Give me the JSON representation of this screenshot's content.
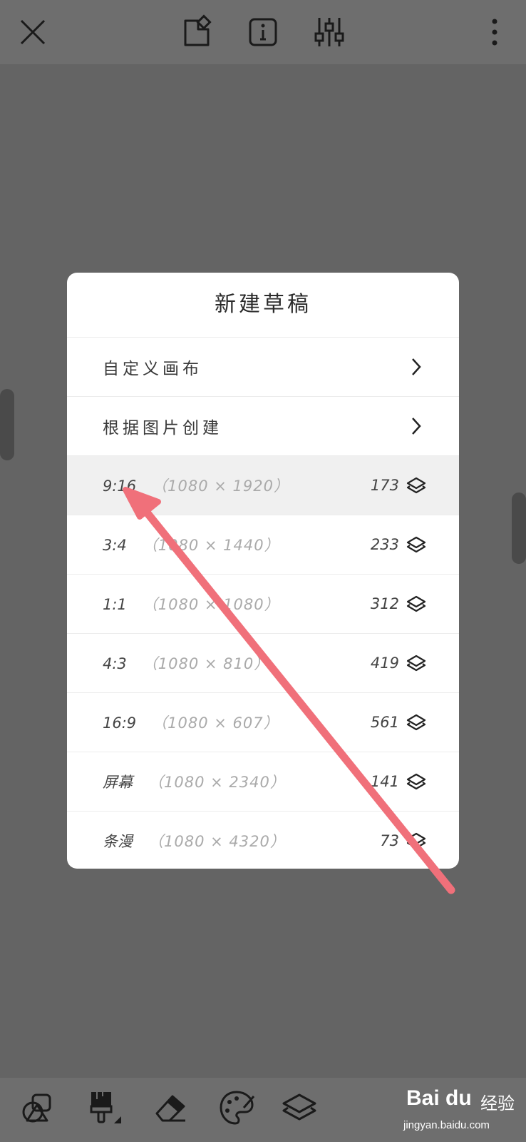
{
  "topbar": {
    "icons": [
      "close-icon",
      "canvas-tag-icon",
      "info-icon",
      "sliders-icon",
      "more-vertical-icon"
    ]
  },
  "dialog": {
    "title": "新建草稿",
    "nav_rows": [
      {
        "label": "自定义画布",
        "icon": "chevron-right-icon"
      },
      {
        "label": "根据图片创建",
        "icon": "chevron-right-icon"
      }
    ],
    "presets": [
      {
        "ratio": "9:16",
        "size": "（1080 × 1920）",
        "layers": "173",
        "highlighted": true
      },
      {
        "ratio": "3:4",
        "size": "（1080 × 1440）",
        "layers": "233",
        "highlighted": false
      },
      {
        "ratio": "1:1",
        "size": "（1080 × 1080）",
        "layers": "312",
        "highlighted": false
      },
      {
        "ratio": "4:3",
        "size": "（1080 × 810）",
        "layers": "419",
        "highlighted": false
      },
      {
        "ratio": "16:9",
        "size": "（1080 × 607）",
        "layers": "561",
        "highlighted": false
      },
      {
        "ratio": "屏幕",
        "size": "（1080 × 2340）",
        "layers": "141",
        "highlighted": false
      },
      {
        "ratio": "条漫",
        "size": "（1080 × 4320）",
        "layers": "73",
        "highlighted": false
      }
    ]
  },
  "bottombar": {
    "icons": [
      "shapes-icon",
      "brush-icon",
      "eraser-icon",
      "palette-icon",
      "layers-icon"
    ]
  },
  "watermark": {
    "logo": "Bai du",
    "suffix": "经验",
    "url": "jingyan.baidu.com"
  },
  "colors": {
    "background": "#646464",
    "bar": "#6e6e6e",
    "dialog": "#ffffff",
    "highlight_row": "#f0f0f0",
    "annotation_arrow": "#f0707a"
  }
}
